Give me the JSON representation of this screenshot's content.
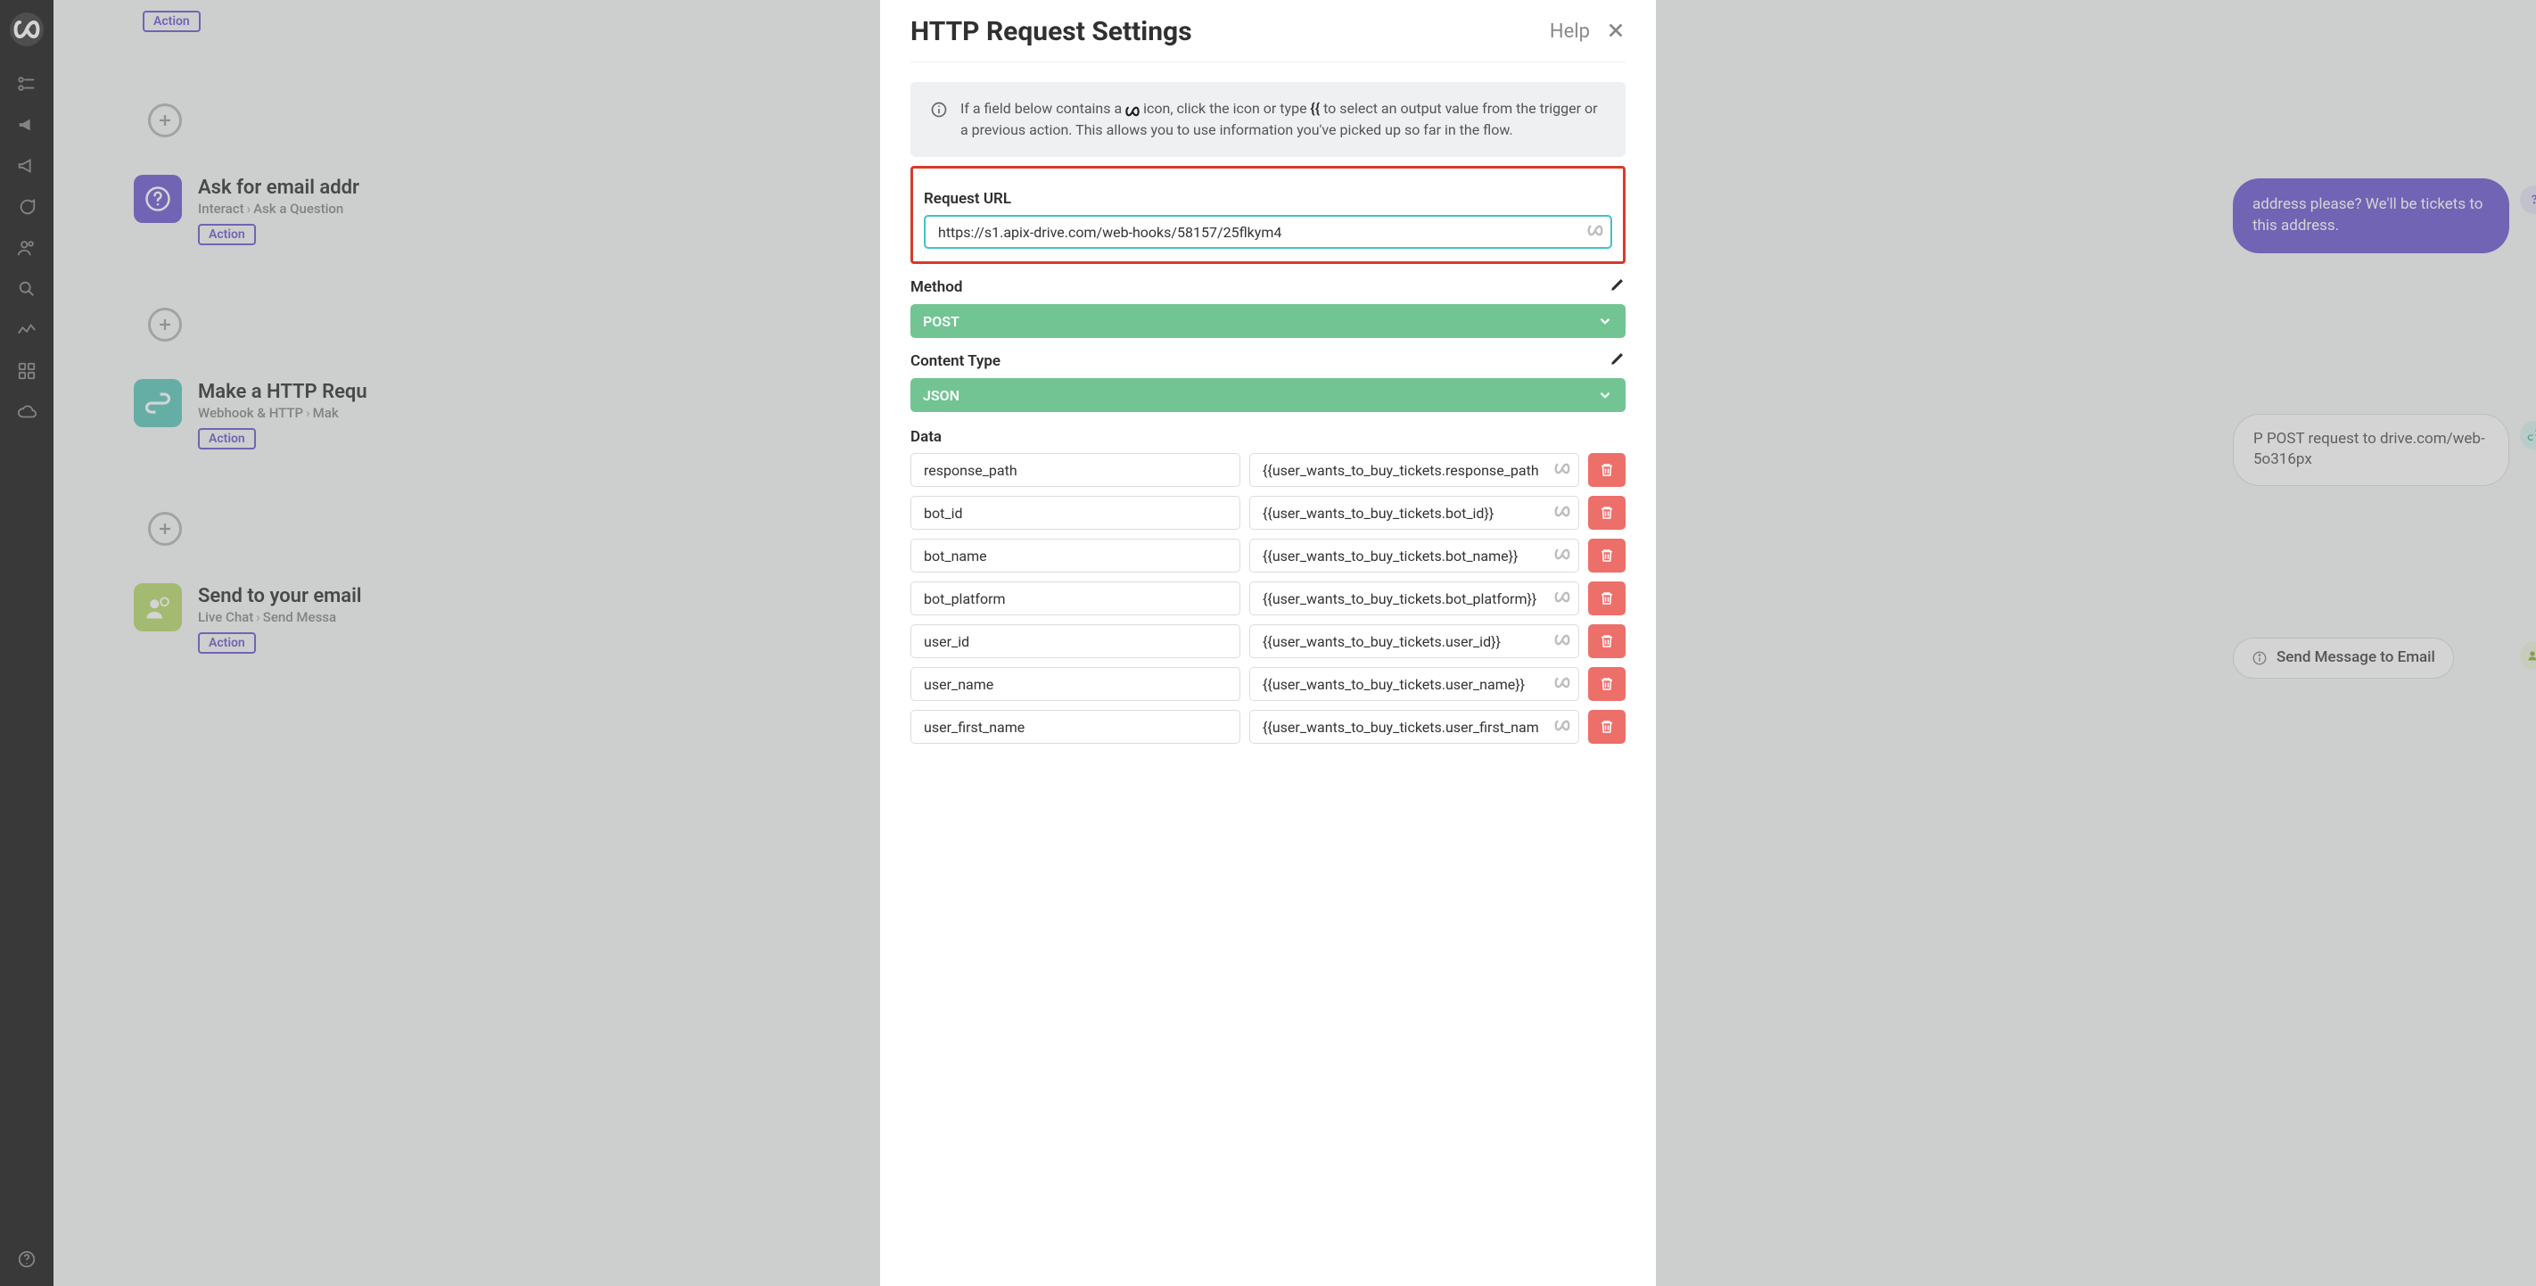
{
  "leftnav": {
    "items": [
      {
        "name": "flows",
        "icon": "flow"
      },
      {
        "name": "megaphone",
        "icon": "megaphone-solid"
      },
      {
        "name": "broadcast",
        "icon": "megaphone-outline"
      },
      {
        "name": "chat",
        "icon": "chat"
      },
      {
        "name": "contacts",
        "icon": "people"
      },
      {
        "name": "search",
        "icon": "search"
      },
      {
        "name": "analytics",
        "icon": "wave"
      },
      {
        "name": "apps",
        "icon": "grid"
      },
      {
        "name": "cloud",
        "icon": "cloud"
      }
    ]
  },
  "canvas": {
    "action_badge": "Action",
    "steps": [
      {
        "icon": "question",
        "color": "purple",
        "title": "Ask for email addr",
        "sub_a": "Interact",
        "sub_b": "Ask a Question"
      },
      {
        "icon": "link",
        "color": "teal",
        "title": "Make a HTTP Requ",
        "sub_a": "Webhook & HTTP",
        "sub_b": "Mak"
      },
      {
        "icon": "person-msg",
        "color": "lime",
        "title": "Send to your email",
        "sub_a": "Live Chat",
        "sub_b": "Send Messa"
      }
    ],
    "col2": {
      "bubble": "address please? We'll be tickets to this address.",
      "card": "P POST request to drive.com/web-5o316px",
      "pill": "Send Message to Email"
    }
  },
  "modal": {
    "title": "HTTP Request Settings",
    "help": "Help",
    "info_pre": "If a field below contains a ",
    "info_mid": " icon, click the icon or type ",
    "info_token": "{{",
    "info_post": " to select an output value from the trigger or a previous action. This allows you to use information you've picked up so far in the flow.",
    "request_url_label": "Request URL",
    "request_url_value": "https://s1.apix-drive.com/web-hooks/58157/25flkym4",
    "method_label": "Method",
    "method_value": "POST",
    "content_type_label": "Content Type",
    "content_type_value": "JSON",
    "data_label": "Data",
    "data_rows": [
      {
        "key": "response_path",
        "val": "{{user_wants_to_buy_tickets.response_path"
      },
      {
        "key": "bot_id",
        "val": "{{user_wants_to_buy_tickets.bot_id}}"
      },
      {
        "key": "bot_name",
        "val": "{{user_wants_to_buy_tickets.bot_name}}"
      },
      {
        "key": "bot_platform",
        "val": "{{user_wants_to_buy_tickets.bot_platform}}"
      },
      {
        "key": "user_id",
        "val": "{{user_wants_to_buy_tickets.user_id}}"
      },
      {
        "key": "user_name",
        "val": "{{user_wants_to_buy_tickets.user_name}}"
      },
      {
        "key": "user_first_name",
        "val": "{{user_wants_to_buy_tickets.user_first_nam"
      }
    ]
  }
}
